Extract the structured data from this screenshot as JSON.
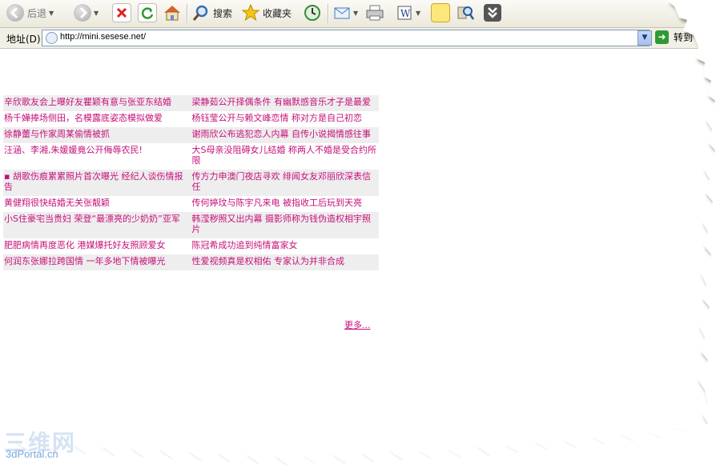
{
  "toolbar": {
    "back_label": "后退",
    "search_label": "搜索",
    "favorites_label": "收藏夹"
  },
  "address_bar": {
    "label": "地址(D)",
    "url": "http://mini.sesese.net/",
    "go_label": "转到"
  },
  "news": [
    [
      "辛欣歌友会上曝好友瞿颖有意与张亚东结婚",
      "梁静茹公开择偶条件 有幽默感音乐才子是最爱"
    ],
    [
      "杨千嬅捧场侧田，名模露底姿态模拟做爱",
      "杨钰莹公开与赖文峰恋情 称对方是自己初恋"
    ],
    [
      "徐静蕾与作家周某偷情被抓",
      "谢雨欣公布逃犯恋人内幕 自传小说揭情感往事"
    ],
    [
      "汪涵、李湘,朱媛媛竟公开侮辱农民!",
      "大S母亲没阻碍女儿结婚 称两人不婚是受合约所限"
    ],
    [
      "▪ 胡歌伤痕累累照片首次曝光 经纪人谈伤情报告",
      "传方力申澳门夜店寻欢 绯闻女友邓丽欣深表信任"
    ],
    [
      "黄健翔很快结婚无关张靓颖",
      "传何婷玟与陈宇凡来电 被指收工后玩到天亮"
    ],
    [
      "小S住豪宅当贵妇 荣登“最漂亮的少奶奶”亚军",
      "韩滢秽照又出内幕 摄影师称为钱伪造权相宇照片"
    ],
    [
      "肥肥病情再度恶化 港媒爆托好友照顾爱女",
      "陈冠希成功追到纯情富家女"
    ],
    [
      "何润东张娜拉跨国情 一年多地下情被曝光",
      "性爱视频真是权相佑 专家认为并非合成"
    ]
  ],
  "more_link": "更多...",
  "watermark": {
    "title": "三维网",
    "site": "3dPortal.cn"
  },
  "colors": {
    "link": "#c5107a",
    "row_alt": "#eeeeee",
    "toolbar_bg": "#ebe8db"
  }
}
